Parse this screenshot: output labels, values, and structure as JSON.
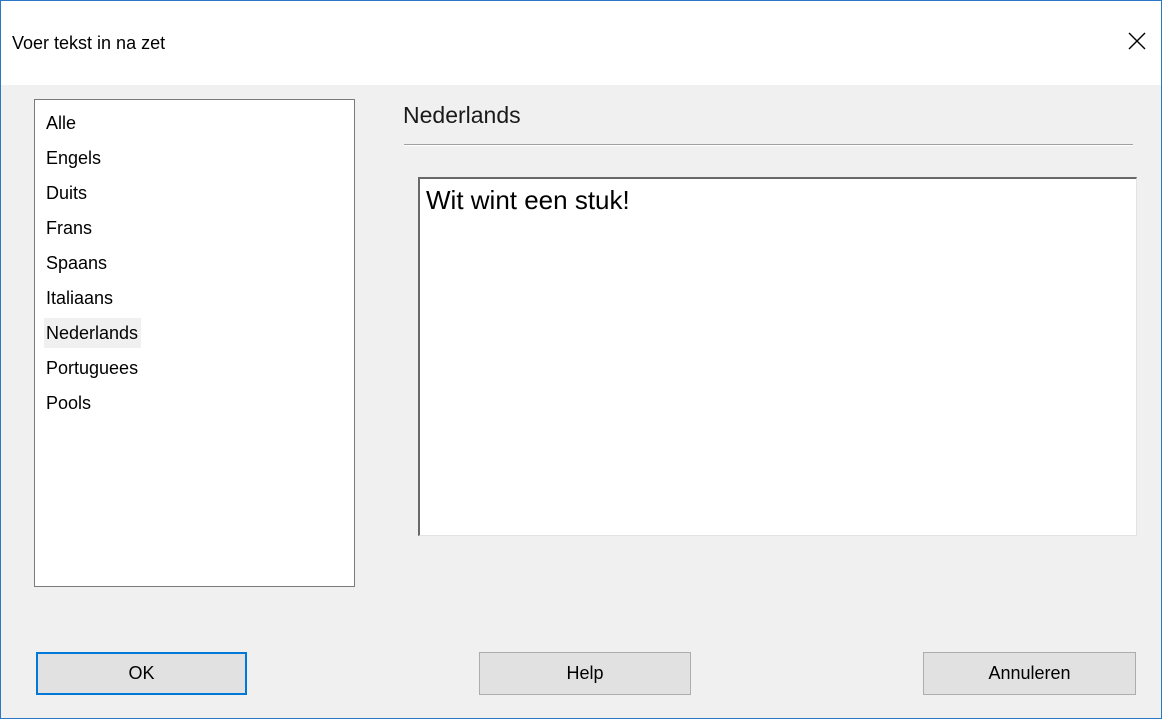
{
  "window": {
    "title": "Voer tekst in na zet"
  },
  "languages": {
    "items": [
      "Alle",
      "Engels",
      "Duits",
      "Frans",
      "Spaans",
      "Italiaans",
      "Nederlands",
      "Portuguees",
      "Pools"
    ],
    "selected": "Nederlands"
  },
  "section": {
    "header": "Nederlands"
  },
  "comment": {
    "value": "Wit wint een stuk!"
  },
  "buttons": {
    "ok": "OK",
    "help": "Help",
    "cancel": "Annuleren"
  },
  "icons": {
    "close": "close-icon"
  },
  "colors": {
    "accent": "#0078d7",
    "window_border": "#2b79c6",
    "background": "#f0f0f0"
  }
}
